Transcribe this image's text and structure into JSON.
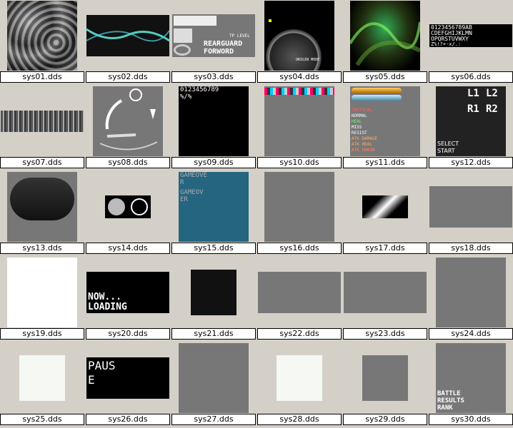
{
  "files": [
    {
      "name": "sys01.dds"
    },
    {
      "name": "sys02.dds"
    },
    {
      "name": "sys03.dds",
      "texts": [
        "REARGUARD",
        "FORWORD",
        "TP LEVEL"
      ]
    },
    {
      "name": "sys04.dds",
      "texts": [
        "ORIGIN MODE"
      ]
    },
    {
      "name": "sys05.dds"
    },
    {
      "name": "sys06.dds",
      "texts": [
        "0123456789AB",
        "CDEFGHIJKLMN",
        "OPQRSTUVWXY",
        "Z%!?+-x/.:"
      ]
    },
    {
      "name": "sys07.dds"
    },
    {
      "name": "sys08.dds"
    },
    {
      "name": "sys09.dds",
      "texts": [
        "0123456789",
        "%/%"
      ]
    },
    {
      "name": "sys10.dds"
    },
    {
      "name": "sys11.dds",
      "texts": [
        "CRITICAL",
        "NORMAL",
        "HEAL",
        "MISS",
        "RESIST",
        "ATK DAMAGE",
        "ATK HEAL",
        "ATK CHAIN"
      ]
    },
    {
      "name": "sys12.dds",
      "texts": [
        "L1",
        "L2",
        "R1",
        "R2",
        "SELECT",
        "START"
      ]
    },
    {
      "name": "sys13.dds"
    },
    {
      "name": "sys14.dds"
    },
    {
      "name": "sys15.dds",
      "texts": [
        "GAMEOVE",
        "R",
        "GAMEOV",
        "ER"
      ]
    },
    {
      "name": "sys16.dds"
    },
    {
      "name": "sys17.dds"
    },
    {
      "name": "sys18.dds"
    },
    {
      "name": "sys19.dds"
    },
    {
      "name": "sys20.dds",
      "texts": [
        "NOW...",
        "LOADING"
      ]
    },
    {
      "name": "sys21.dds"
    },
    {
      "name": "sys22.dds"
    },
    {
      "name": "sys23.dds"
    },
    {
      "name": "sys24.dds"
    },
    {
      "name": "sys25.dds"
    },
    {
      "name": "sys26.dds",
      "texts": [
        "PAUS",
        "E"
      ]
    },
    {
      "name": "sys27.dds"
    },
    {
      "name": "sys28.dds"
    },
    {
      "name": "sys29.dds"
    },
    {
      "name": "sys30.dds",
      "texts": [
        "BATTLE",
        "RESULTS",
        "RANK"
      ]
    }
  ]
}
